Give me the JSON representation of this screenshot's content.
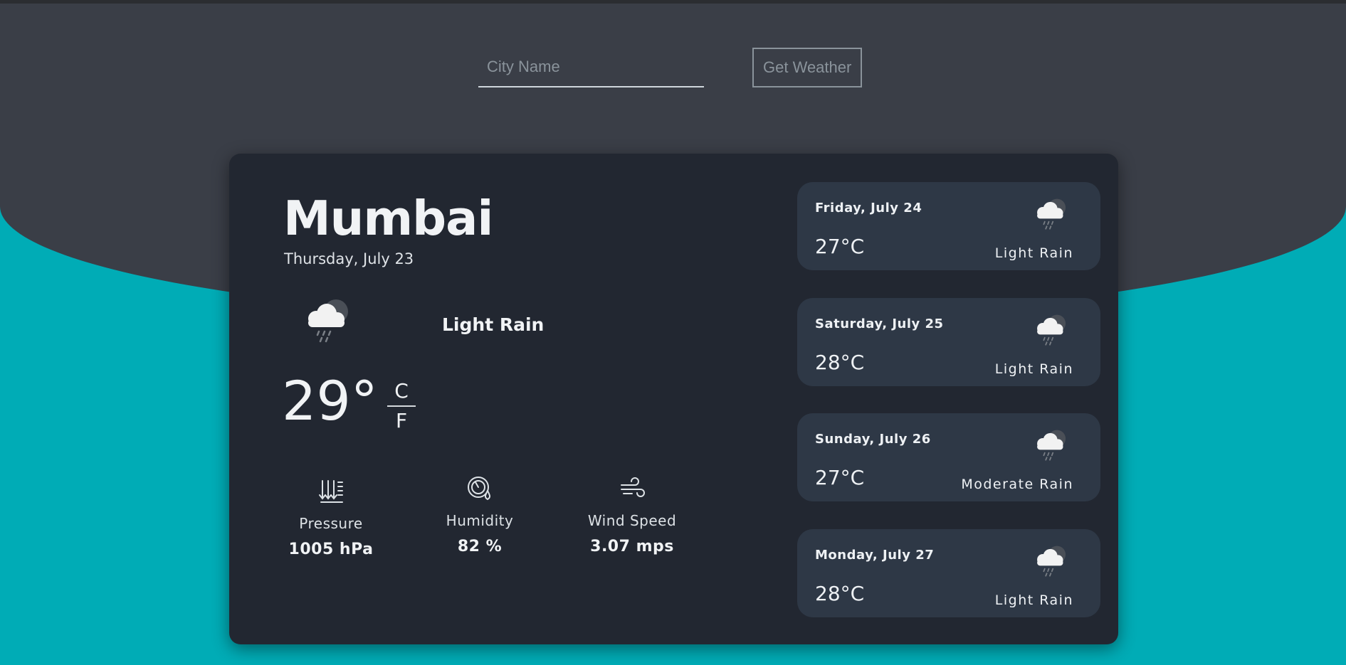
{
  "search": {
    "placeholder": "City Name",
    "button_label": "Get Weather"
  },
  "current": {
    "city": "Mumbai",
    "date": "Thursday, July 23",
    "icon": "cloud-rain-moon-icon",
    "description": "Light Rain",
    "temperature": "29°",
    "unit_c": "C",
    "unit_f": "F"
  },
  "stats": [
    {
      "icon": "pressure-icon",
      "label": "Pressure",
      "value": "1005 hPa"
    },
    {
      "icon": "humidity-icon",
      "label": "Humidity",
      "value": "82 %"
    },
    {
      "icon": "wind-icon",
      "label": "Wind Speed",
      "value": "3.07 mps"
    }
  ],
  "forecast": [
    {
      "day": "Friday, July 24",
      "temp": "27°C",
      "description": "Light Rain",
      "icon": "cloud-rain-moon-icon"
    },
    {
      "day": "Saturday, July 25",
      "temp": "28°C",
      "description": "Light Rain",
      "icon": "cloud-rain-moon-icon"
    },
    {
      "day": "Sunday, July 26",
      "temp": "27°C",
      "description": "Moderate Rain",
      "icon": "cloud-rain-moon-icon"
    },
    {
      "day": "Monday, July 27",
      "temp": "28°C",
      "description": "Light Rain",
      "icon": "cloud-rain-moon-icon"
    }
  ],
  "colors": {
    "background_accent": "#00acb6",
    "header_bg": "#3a3e47",
    "card_bg": "#222731",
    "forecast_bg": "#2e3846"
  }
}
